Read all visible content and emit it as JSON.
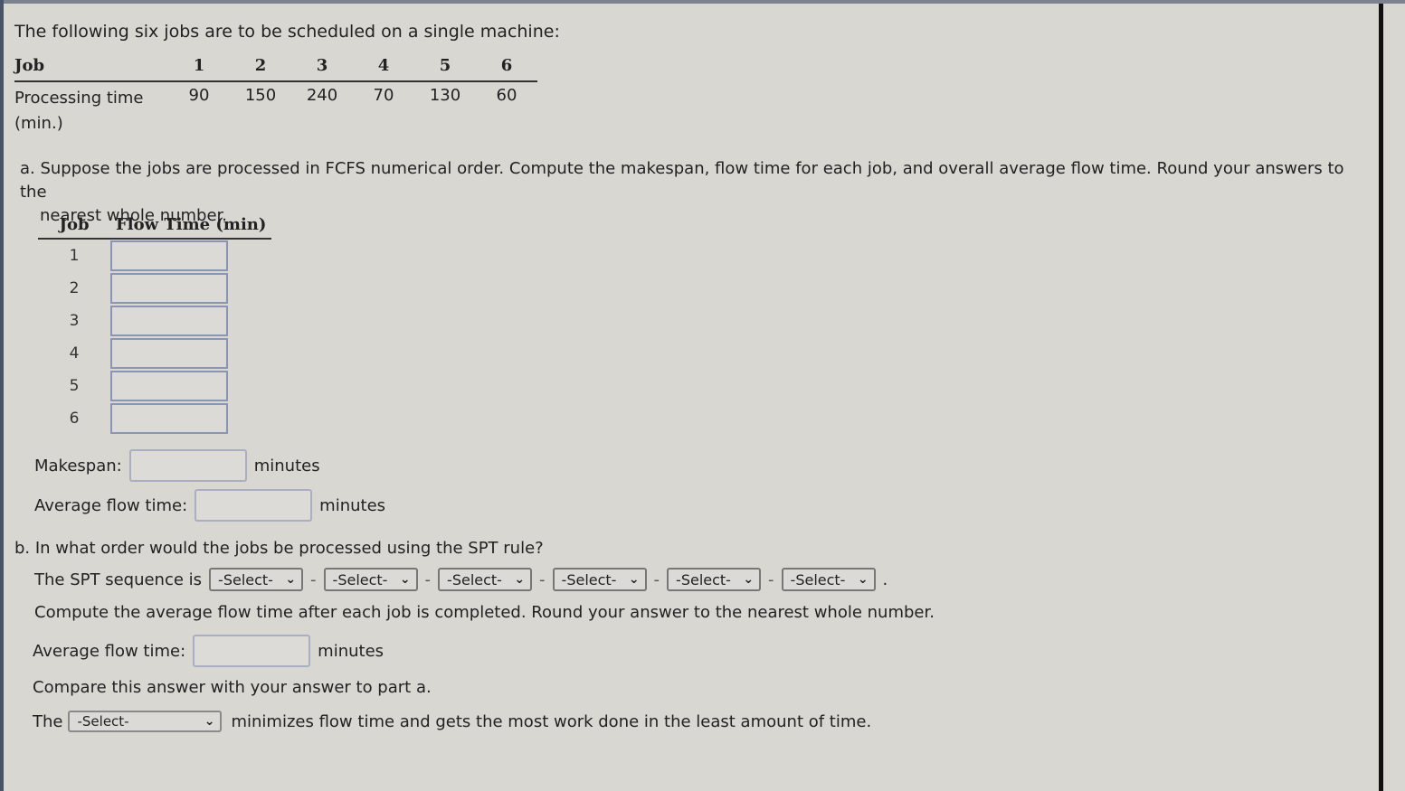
{
  "intro": "The following six jobs are to be scheduled on a single machine:",
  "jobs_table": {
    "row_header": "Job",
    "jobs": [
      "1",
      "2",
      "3",
      "4",
      "5",
      "6"
    ],
    "processing_label_line1": "Processing time",
    "processing_label_line2": "(min.)",
    "processing_times": [
      "90",
      "150",
      "240",
      "70",
      "130",
      "60"
    ]
  },
  "part_a": {
    "line1": "a. Suppose the jobs are processed in FCFS numerical order. Compute the makespan, flow time for each job, and overall average flow time. Round your answers to the",
    "line2": "nearest whole number.",
    "flow_table": {
      "col_job": "Job",
      "col_flow": "Flow Time (min)",
      "rows": [
        {
          "job": "1",
          "value": ""
        },
        {
          "job": "2",
          "value": ""
        },
        {
          "job": "3",
          "value": ""
        },
        {
          "job": "4",
          "value": ""
        },
        {
          "job": "5",
          "value": ""
        },
        {
          "job": "6",
          "value": ""
        }
      ]
    },
    "makespan_label": "Makespan:",
    "makespan_value": "",
    "makespan_unit": "minutes",
    "avg_flow_label": "Average flow time:",
    "avg_flow_value": "",
    "avg_flow_unit": "minutes"
  },
  "part_b": {
    "question": "b. In what order would the jobs be processed using the SPT rule?",
    "spt_label": "The SPT sequence is",
    "spt_selects": [
      "-Select-",
      "-Select-",
      "-Select-",
      "-Select-",
      "-Select-",
      "-Select-"
    ],
    "separator": "-",
    "end_period": ".",
    "compute_text": "Compute the average flow time after each job is completed. Round your answer to the nearest whole number.",
    "avg_flow_label": "Average flow time:",
    "avg_flow_value": "",
    "avg_flow_unit": "minutes",
    "compare_text": "Compare this answer with your answer to part a.",
    "the_label": "The",
    "rule_select": "-Select-",
    "conclusion": "minimizes flow time and gets the most work done in the least amount of time."
  }
}
